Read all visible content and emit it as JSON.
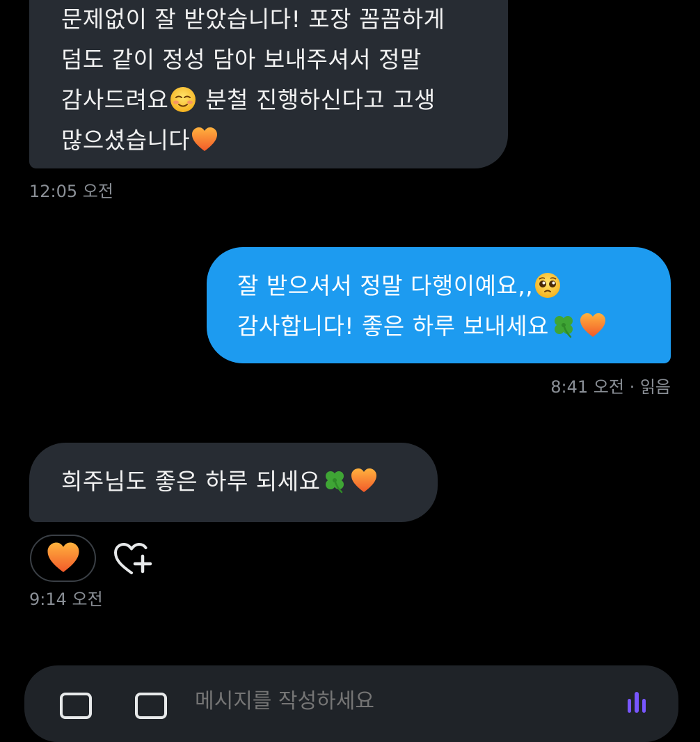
{
  "colors": {
    "background": "#000000",
    "incoming_bubble": "#272c33",
    "outgoing_bubble": "#1d9bf0",
    "meta_text": "#8a8f96",
    "composer_bg": "#1f2328",
    "voice_accent": "#7856ff"
  },
  "messages": [
    {
      "direction": "incoming",
      "lines": [
        {
          "text": "문제없이 잘 받았습니다! 포장 꼼꼼하게",
          "emoji": ""
        },
        {
          "text": "덤도 같이 정성 담아 보내주셔서 정말",
          "emoji": ""
        },
        {
          "text": "감사드려요",
          "emoji": "smiling-face-icon",
          "after": " 분철 진행하신다고 고생"
        },
        {
          "text": "많으셨습니다",
          "emoji": "orange-heart-icon"
        }
      ],
      "meta": "12:05 오전"
    },
    {
      "direction": "outgoing",
      "lines": [
        {
          "text": "잘 받으셔서 정말 다행이예요,,",
          "emoji": "pleading-face-icon"
        },
        {
          "text": "감사합니다! 좋은 하루 보내세요",
          "emoji": "four-leaf-clover-icon",
          "emoji2": "orange-heart-icon"
        }
      ],
      "meta": "8:41 오전 · 읽음"
    },
    {
      "direction": "incoming",
      "lines": [
        {
          "text": "희주님도 좋은 하루 되세요",
          "emoji": "four-leaf-clover-icon",
          "emoji2": "orange-heart-icon"
        }
      ],
      "reaction": "orange-heart-icon",
      "add_reaction_icon": "heart-plus-icon",
      "meta": "9:14 오전"
    }
  ],
  "composer": {
    "placeholder": "메시지를 작성하세요",
    "icons": [
      "gif-icon",
      "image-icon",
      "voice-icon"
    ]
  }
}
